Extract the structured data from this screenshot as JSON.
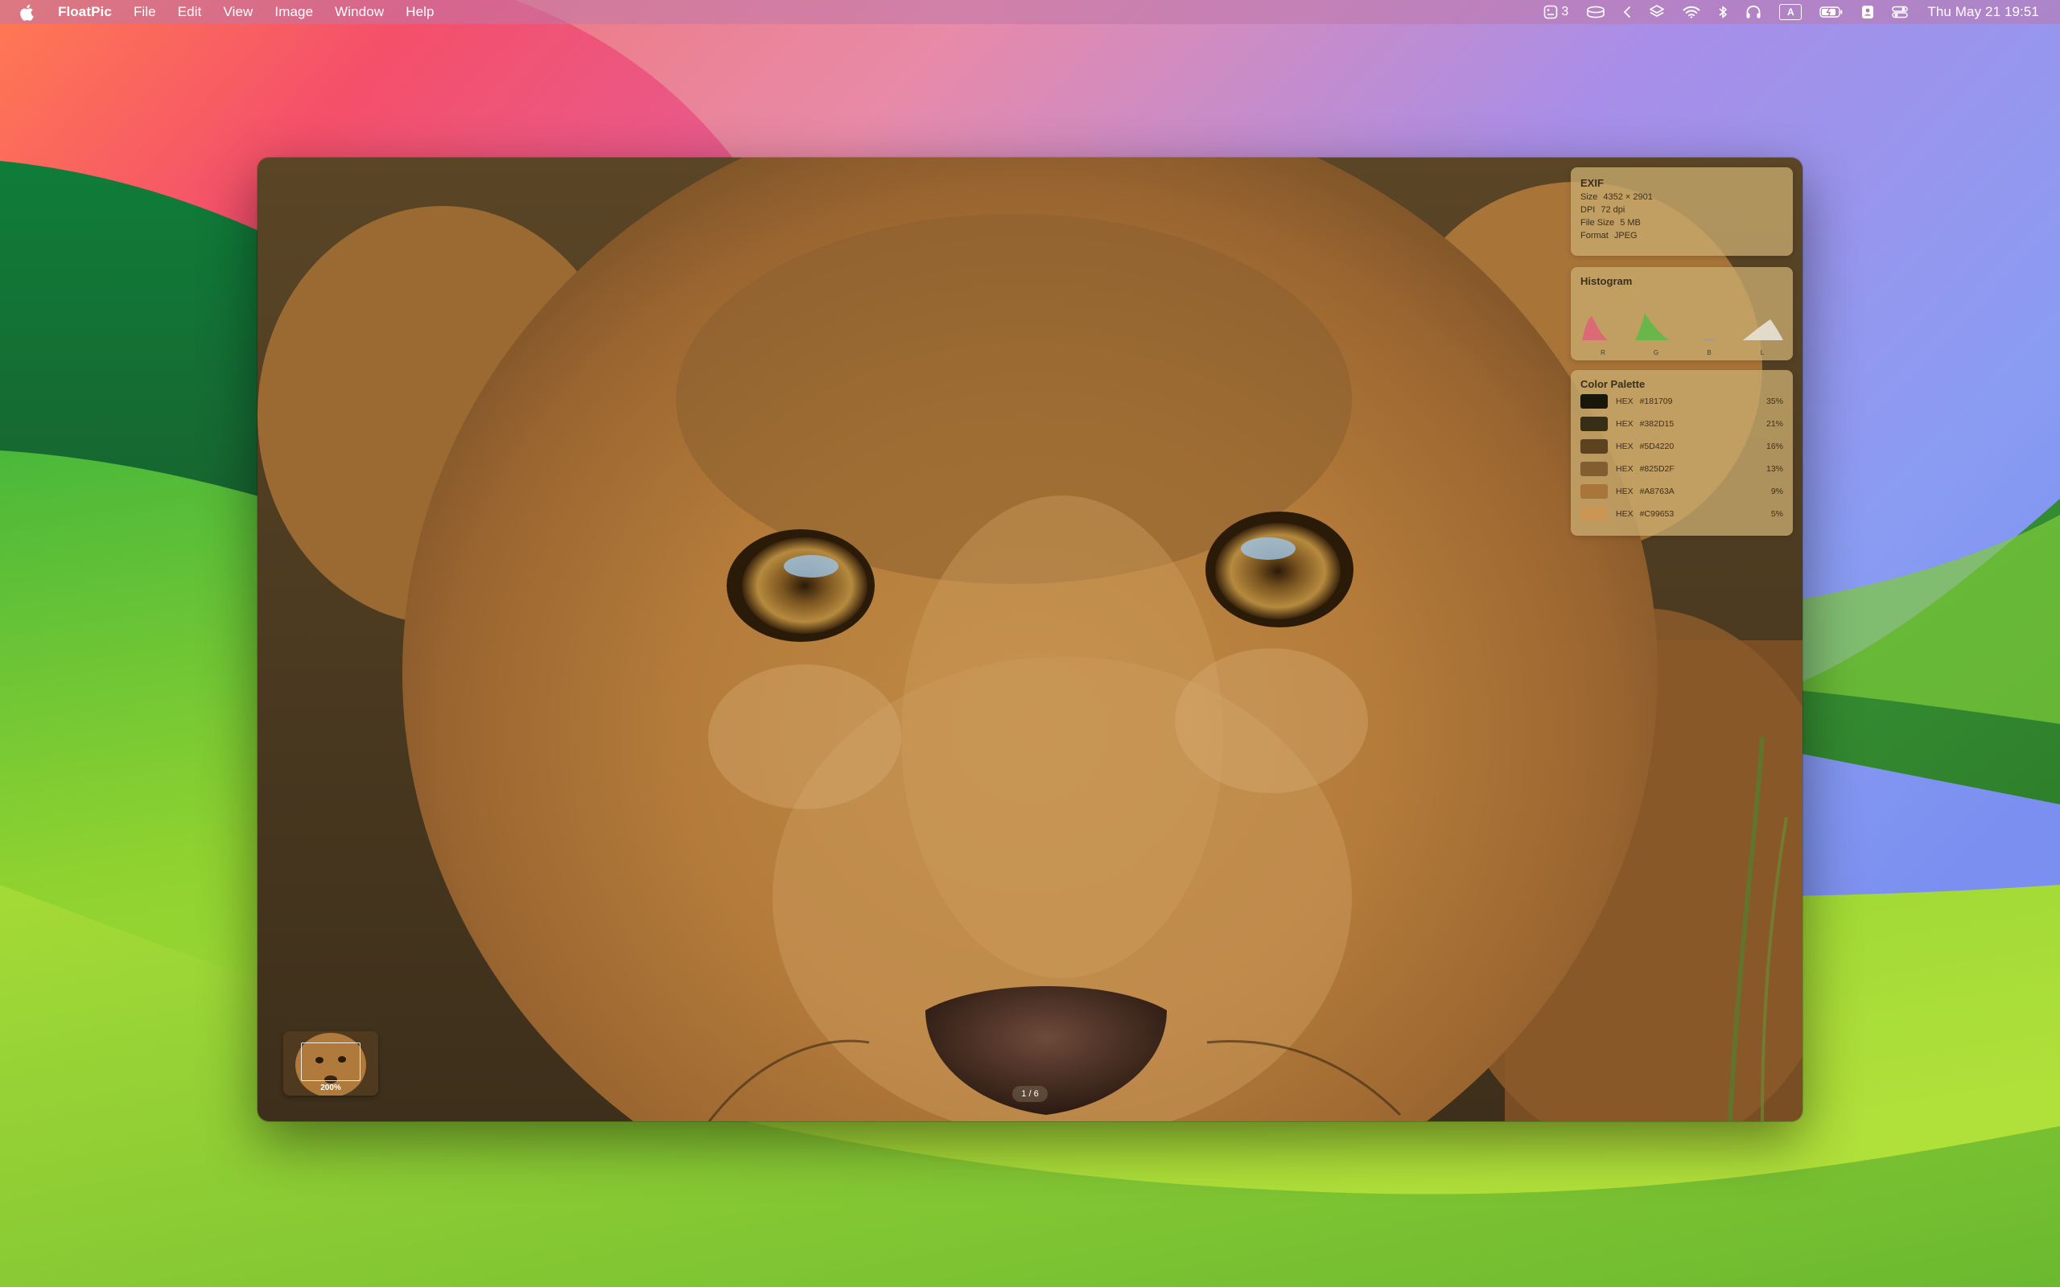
{
  "menubar": {
    "app_name": "FloatPic",
    "menus": [
      "File",
      "Edit",
      "View",
      "Image",
      "Window",
      "Help"
    ],
    "notification_count": "3",
    "clock": "Thu May 21  19:51",
    "input_source": "A"
  },
  "viewer": {
    "exif": {
      "title": "EXIF",
      "rows": [
        {
          "key": "Size",
          "value": "4352 × 2901"
        },
        {
          "key": "DPI",
          "value": "72 dpi"
        },
        {
          "key": "File Size",
          "value": "5 MB"
        },
        {
          "key": "Format",
          "value": "JPEG"
        }
      ]
    },
    "histogram": {
      "title": "Histogram",
      "channels": [
        {
          "label": "R",
          "color": "#e0607a"
        },
        {
          "label": "G",
          "color": "#5fb848"
        },
        {
          "label": "B",
          "color": "#6a84d8"
        },
        {
          "label": "L",
          "color": "#e8e2d6"
        }
      ]
    },
    "palette": {
      "title": "Color Palette",
      "hex_label": "HEX",
      "colors": [
        {
          "hex": "#181709",
          "percent": "35%"
        },
        {
          "hex": "#382D15",
          "percent": "21%"
        },
        {
          "hex": "#5D4220",
          "percent": "16%"
        },
        {
          "hex": "#825D2F",
          "percent": "13%"
        },
        {
          "hex": "#A8763A",
          "percent": "9%"
        },
        {
          "hex": "#C99653",
          "percent": "5%"
        }
      ]
    },
    "navigator": {
      "zoom": "200%"
    },
    "page_counter": "1 / 6"
  },
  "colors": {
    "menubar_bg": "#be78aa",
    "panel_bg": "#c8aa6e"
  }
}
